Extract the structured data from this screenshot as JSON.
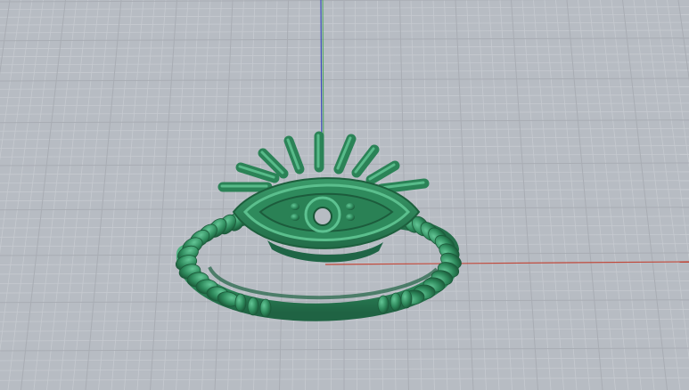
{
  "viewport": {
    "background_color": "#b7bcc3",
    "grid_minor_color": "#c6cad0",
    "grid_major_color": "#a9adb4",
    "x_axis_color": "#c0483a",
    "y_axis_color": "#4aa65a",
    "z_axis_color": "#3c4ab8"
  },
  "model": {
    "name": "evil-eye-ring",
    "color": "#2e8a5c",
    "shadow_color": "#1d5f3d",
    "highlight_color": "#49b07c"
  }
}
